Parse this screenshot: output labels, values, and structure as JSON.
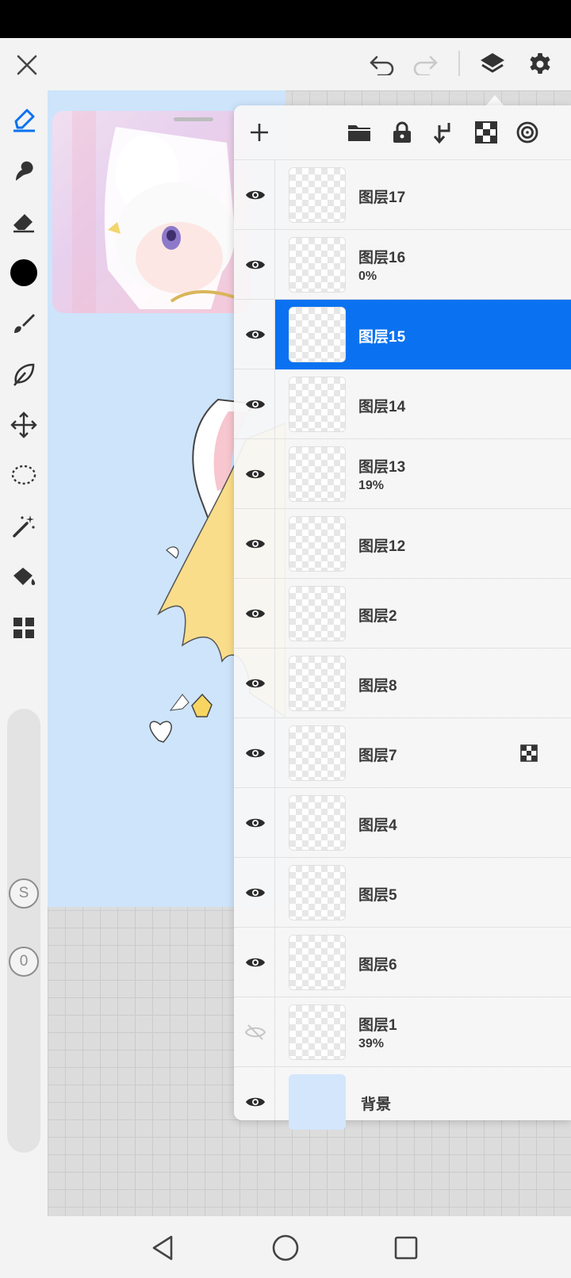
{
  "topbar": {
    "close_icon": "close-icon",
    "undo_icon": "undo-icon",
    "redo_icon": "redo-icon",
    "layers_icon": "layers-icon",
    "settings_icon": "gear-icon"
  },
  "toolbar": {
    "tools": [
      "pen",
      "smudge",
      "eraser",
      "color",
      "brush",
      "leaf-blur",
      "transform",
      "lasso",
      "magic-wand",
      "fill",
      "more-tools"
    ],
    "current_color": "#000000",
    "slider_size_label": "S",
    "slider_opacity_label": "0"
  },
  "layers_panel": {
    "header_icons": [
      "add-layer",
      "folder",
      "lock",
      "merge-down",
      "alpha-lock",
      "clipping"
    ],
    "layers": [
      {
        "name": "图层17",
        "opacity": "",
        "visible": true,
        "selected": false,
        "alpha_lock": false
      },
      {
        "name": "图层16",
        "opacity": "0%",
        "visible": true,
        "selected": false,
        "alpha_lock": false
      },
      {
        "name": "图层15",
        "opacity": "",
        "visible": true,
        "selected": true,
        "alpha_lock": false
      },
      {
        "name": "图层14",
        "opacity": "",
        "visible": true,
        "selected": false,
        "alpha_lock": false
      },
      {
        "name": "图层13",
        "opacity": "19%",
        "visible": true,
        "selected": false,
        "alpha_lock": false
      },
      {
        "name": "图层12",
        "opacity": "",
        "visible": true,
        "selected": false,
        "alpha_lock": false
      },
      {
        "name": "图层2",
        "opacity": "",
        "visible": true,
        "selected": false,
        "alpha_lock": false
      },
      {
        "name": "图层8",
        "opacity": "",
        "visible": true,
        "selected": false,
        "alpha_lock": false
      },
      {
        "name": "图层7",
        "opacity": "",
        "visible": true,
        "selected": false,
        "alpha_lock": true
      },
      {
        "name": "图层4",
        "opacity": "",
        "visible": true,
        "selected": false,
        "alpha_lock": false
      },
      {
        "name": "图层5",
        "opacity": "",
        "visible": true,
        "selected": false,
        "alpha_lock": false
      },
      {
        "name": "图层6",
        "opacity": "",
        "visible": true,
        "selected": false,
        "alpha_lock": false
      },
      {
        "name": "图层1",
        "opacity": "39%",
        "visible": false,
        "selected": false,
        "alpha_lock": false
      }
    ],
    "background_layer": {
      "name": "背景",
      "color": "#d3e6fb",
      "visible": true
    }
  },
  "colors": {
    "accent": "#0a72f0",
    "canvas_bg": "#cde4fb"
  },
  "navbar": {
    "buttons": [
      "back",
      "home",
      "recents"
    ]
  }
}
